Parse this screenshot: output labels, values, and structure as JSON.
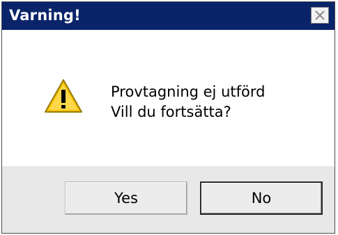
{
  "window": {
    "title": "Varning!"
  },
  "icons": {
    "close": "close-icon",
    "alert": "warning-icon"
  },
  "message": {
    "line1": "Provtagning ej utförd",
    "line2": "Vill du fortsätta?"
  },
  "buttons": {
    "yes_label": "Yes",
    "no_label": "No"
  },
  "colors": {
    "titlebar": "#0a246a",
    "warning_yellow": "#f5c400"
  }
}
